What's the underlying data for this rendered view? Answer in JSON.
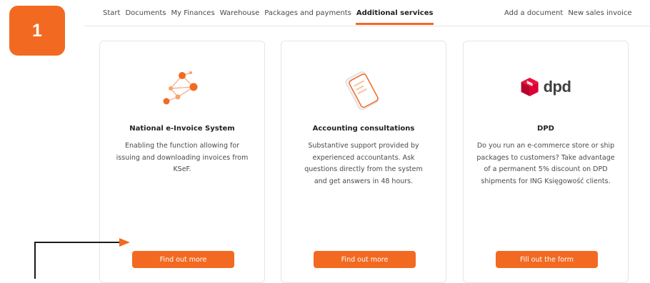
{
  "step_badge": "1",
  "nav": {
    "left_items": [
      {
        "label": "Start"
      },
      {
        "label": "Documents"
      },
      {
        "label": "My Finances"
      },
      {
        "label": "Warehouse"
      },
      {
        "label": "Packages and payments"
      },
      {
        "label": "Additional services",
        "active": true
      }
    ],
    "right_items": [
      {
        "label": "Add a document"
      },
      {
        "label": "New sales invoice"
      }
    ]
  },
  "cards": [
    {
      "title": "National e-Invoice System",
      "description": "Enabling the function allowing for issuing and downloading invoices from KSeF.",
      "button": "Find out more",
      "icon": "network-nodes-icon"
    },
    {
      "title": "Accounting consultations",
      "description": "Substantive support provided by experienced accountants. Ask questions directly from the system and get answers in 48 hours.",
      "button": "Find out more",
      "icon": "smartphone-icon"
    },
    {
      "title": "DPD",
      "description": "Do you run an e-commerce store or ship packages to customers? Take advantage of a permanent 5% discount on DPD shipments for ING Księgowość clients.",
      "button": "Fill out the form",
      "icon": "dpd-logo",
      "logo_text": "dpd"
    }
  ],
  "colors": {
    "accent": "#f26a21",
    "dpd_red": "#dc0032",
    "arrow": "#1a1a1a"
  }
}
